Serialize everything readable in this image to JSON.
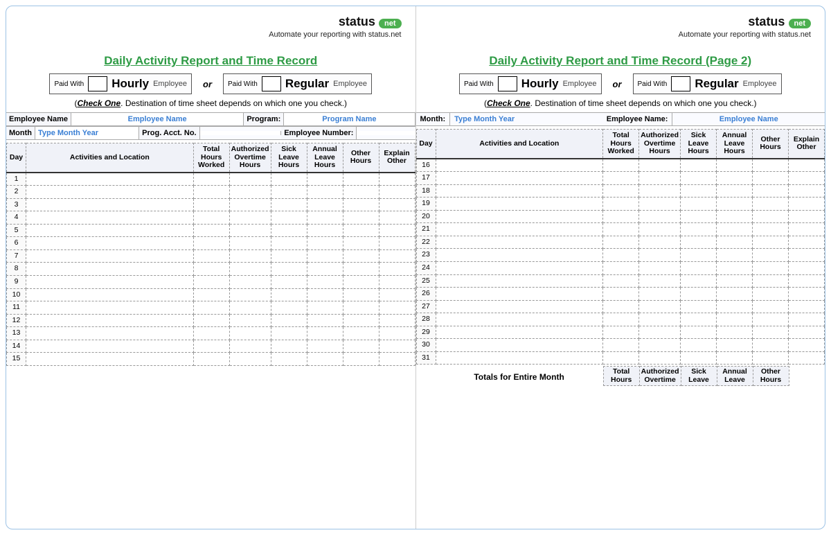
{
  "brand": {
    "name": "status",
    "badge": "net",
    "tagline": "Automate your reporting with status.net"
  },
  "page1": {
    "title": "Daily Activity Report and Time Record",
    "paid_with": "Paid With",
    "hourly": "Hourly",
    "regular": "Regular",
    "employee_suffix": "Employee",
    "or": "or",
    "check_one": "Check One",
    "check_one_text": ".  Destination of time sheet depends on which one you check.)",
    "employee_name_label": "Employee Name",
    "employee_name_value": "Employee Name",
    "program_label": "Program:",
    "program_value": "Program Name",
    "month_label": "Month",
    "month_value": "Type Month Year",
    "prog_acct_label": "Prog. Acct. No.",
    "emp_number_label": "Employee Number:",
    "columns": {
      "day": "Day",
      "activities": "Activities and Location",
      "total_hours": "Total\nHours\nWorked",
      "auth_ot": "Authorized\nOvertime\nHours",
      "sick": "Sick\nLeave\nHours",
      "annual": "Annual\nLeave\nHours",
      "other": "Other\nHours",
      "explain": "Explain\nOther"
    },
    "days": [
      1,
      2,
      3,
      4,
      5,
      6,
      7,
      8,
      9,
      10,
      11,
      12,
      13,
      14,
      15
    ]
  },
  "page2": {
    "title": "Daily Activity Report and Time Record (Page 2)",
    "paid_with": "Paid With",
    "hourly": "Hourly",
    "regular": "Regular",
    "employee_suffix": "Employee",
    "or": "or",
    "check_one": "Check One",
    "check_one_text": ".  Destination of time sheet depends on which one you check.)",
    "month_label": "Month:",
    "month_value": "Type Month Year",
    "employee_name_label": "Employee Name:",
    "employee_name_value": "Employee Name",
    "columns": {
      "day": "Day",
      "activities": "Activities and Location",
      "total_hours": "Total\nHours\nWorked",
      "auth_ot": "Authorized\nOvertime\nHours",
      "sick": "Sick\nLeave\nHours",
      "annual": "Annual\nLeave\nHours",
      "other": "Other\nHours",
      "explain": "Explain\nOther"
    },
    "days": [
      16,
      17,
      18,
      19,
      20,
      21,
      22,
      23,
      24,
      25,
      26,
      27,
      28,
      29,
      30,
      31
    ],
    "totals_label": "Totals for Entire Month",
    "footer_cols": {
      "total_hours": "Total\nHours",
      "auth_ot": "Authorized\nOvertime",
      "sick": "Sick\nLeave",
      "annual": "Annual\nLeave",
      "other": "Other\nHours"
    }
  }
}
